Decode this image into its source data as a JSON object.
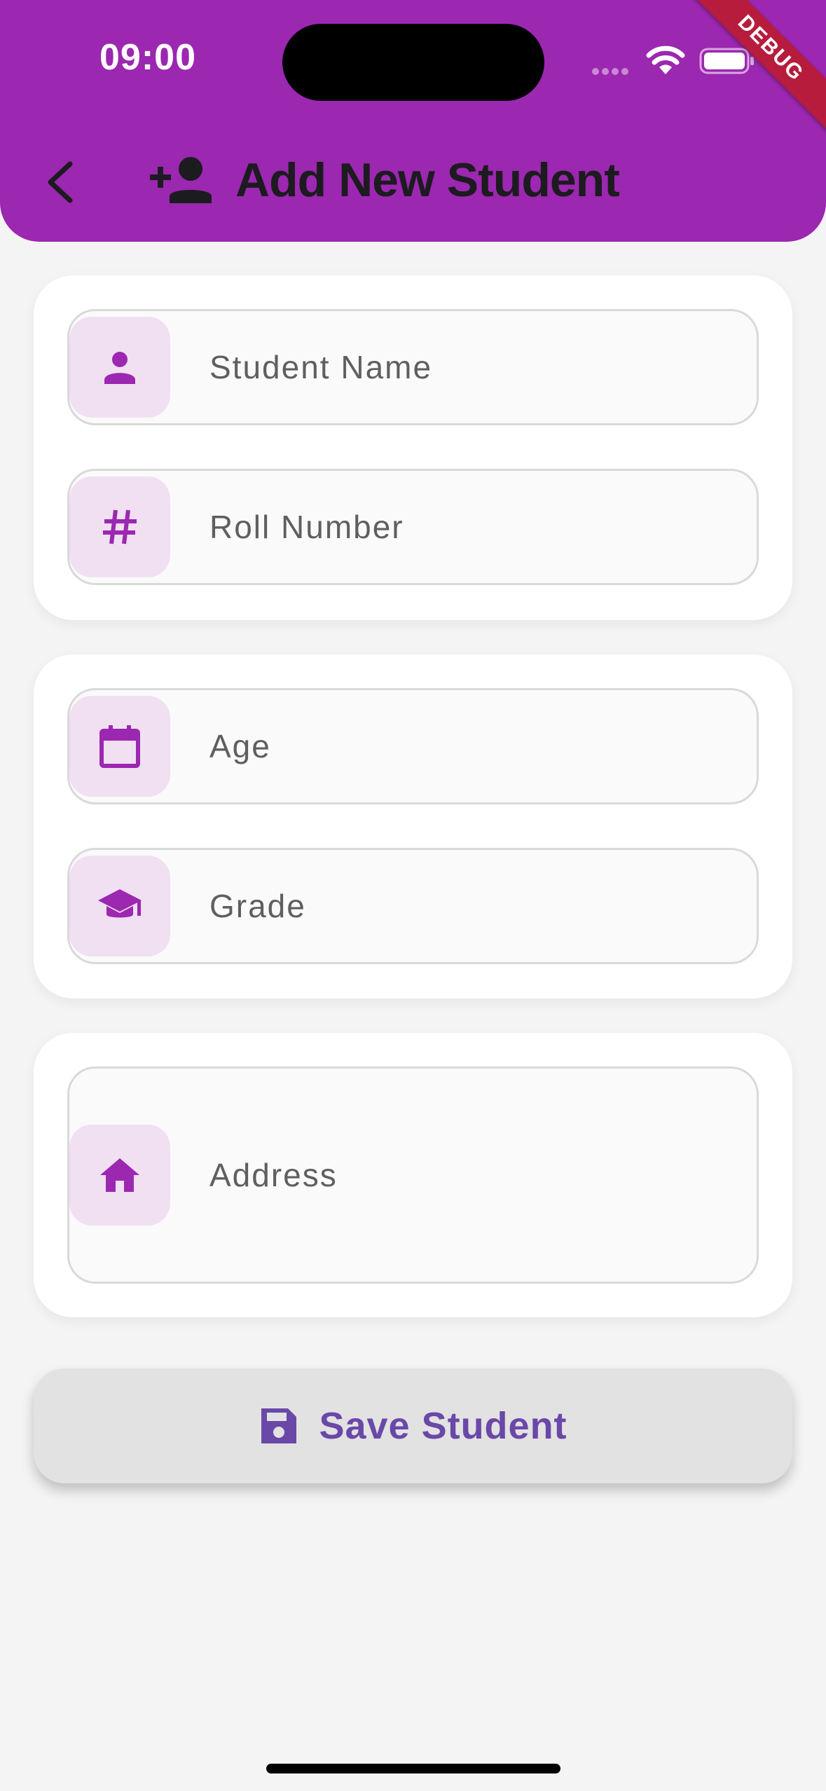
{
  "status_bar": {
    "time": "09:00"
  },
  "debug_banner": {
    "label": "DEBUG"
  },
  "header": {
    "title": "Add New Student"
  },
  "form": {
    "fields": [
      {
        "label": "Student Name",
        "icon": "person-icon"
      },
      {
        "label": "Roll Number",
        "icon": "hash-icon"
      },
      {
        "label": "Age",
        "icon": "calendar-icon"
      },
      {
        "label": "Grade",
        "icon": "graduation-cap-icon"
      },
      {
        "label": "Address",
        "icon": "home-icon"
      }
    ]
  },
  "save_button": {
    "label": "Save Student",
    "icon": "save-icon"
  },
  "colors": {
    "primary": "#9c27b0",
    "icon_background": "#f0e0f2",
    "button_text": "#6a48a8",
    "background": "#f4f4f4"
  }
}
